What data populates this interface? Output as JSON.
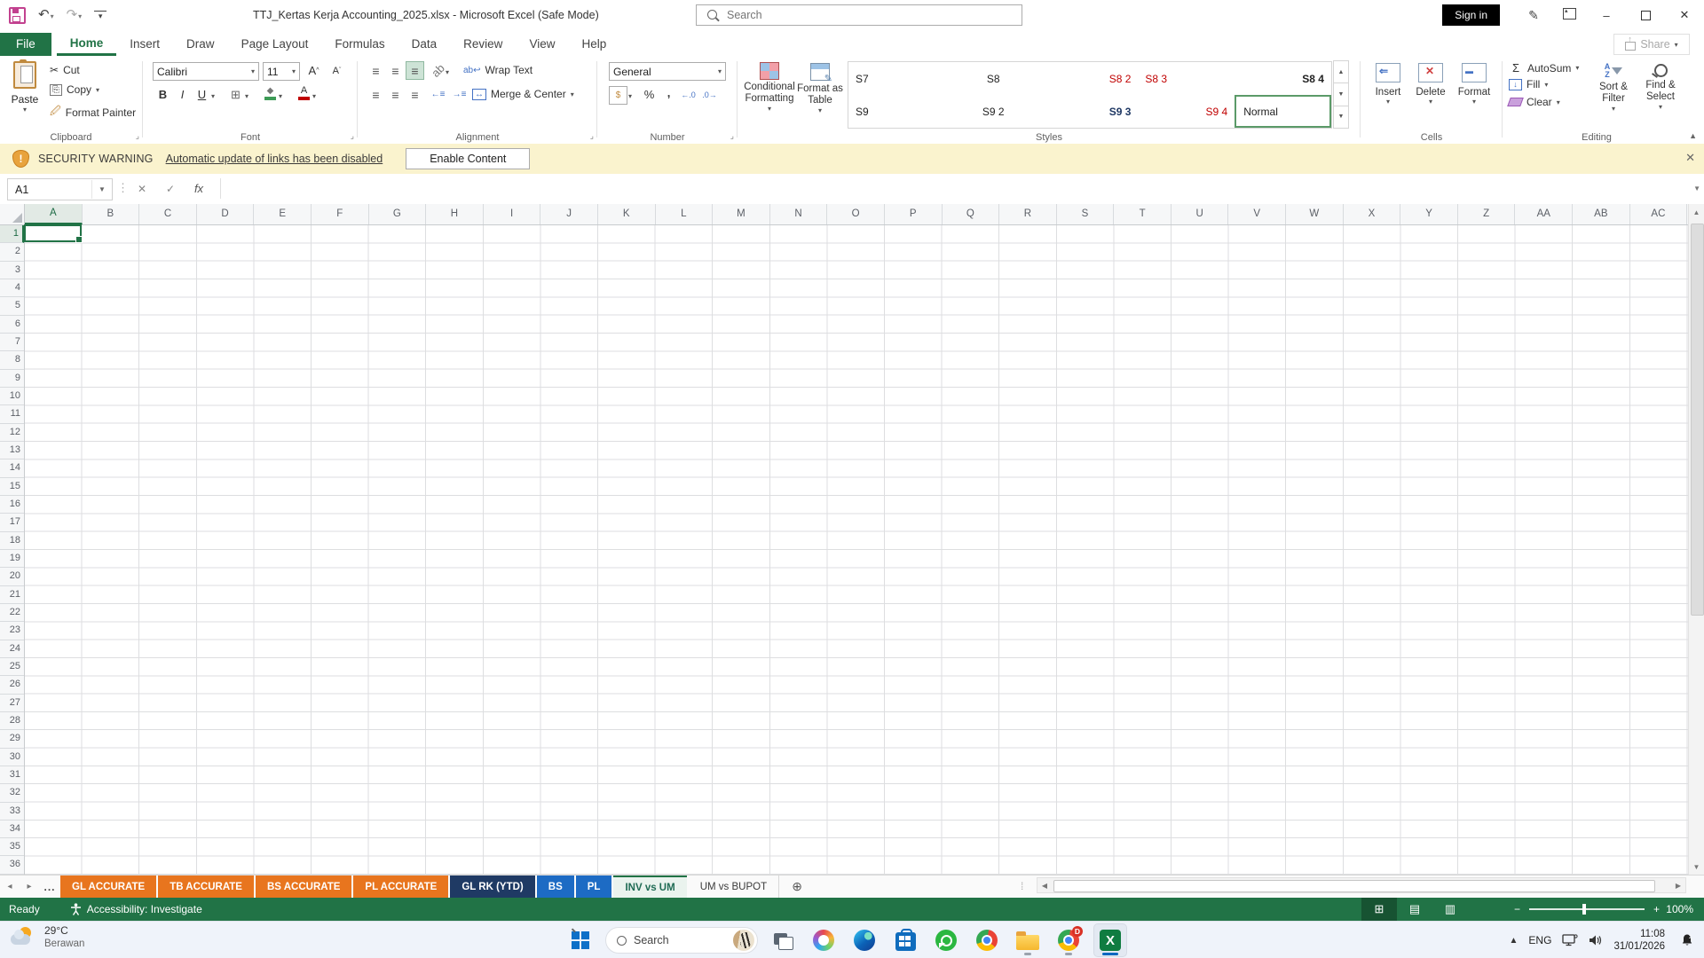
{
  "window": {
    "title": "TTJ_Kertas Kerja Accounting_2025.xlsx  -  Microsoft Excel (Safe Mode)",
    "search_placeholder": "Search",
    "sign_in_label": "Sign in",
    "share_label": "Share"
  },
  "ribbon": {
    "tabs": [
      {
        "label": "File",
        "file": true
      },
      {
        "label": "Home",
        "active": true
      },
      {
        "label": "Insert"
      },
      {
        "label": "Draw"
      },
      {
        "label": "Page Layout"
      },
      {
        "label": "Formulas"
      },
      {
        "label": "Data"
      },
      {
        "label": "Review"
      },
      {
        "label": "View"
      },
      {
        "label": "Help"
      }
    ],
    "clipboard": {
      "group": "Clipboard",
      "paste": "Paste",
      "cut": "Cut",
      "copy": "Copy",
      "format_painter": "Format Painter"
    },
    "font": {
      "group": "Font",
      "family": "Calibri",
      "size": "11"
    },
    "alignment": {
      "group": "Alignment",
      "wrap": "Wrap Text",
      "merge": "Merge & Center"
    },
    "number": {
      "group": "Number",
      "format": "General"
    },
    "styles": {
      "group": "Styles",
      "conditional": "Conditional Formatting",
      "format_table": "Format as Table",
      "gallery": [
        [
          {
            "label": "S7",
            "color": "#222222",
            "align": "left"
          },
          {
            "label": "S8",
            "color": "#222222",
            "align": "center"
          },
          {
            "label": "S8 2",
            "color": "#C00000",
            "align": "right"
          },
          {
            "label": "S8 3",
            "color": "#C00000",
            "align": "left"
          },
          {
            "label": "S8 4",
            "color": "#222222",
            "bold": true,
            "align": "right"
          }
        ],
        [
          {
            "label": "S9",
            "color": "#222222",
            "align": "left"
          },
          {
            "label": "S9 2",
            "color": "#222222",
            "align": "center"
          },
          {
            "label": "S9 3",
            "color": "#1F3864",
            "bold": true,
            "align": "right"
          },
          {
            "label": "S9 4",
            "color": "#C00000",
            "align": "right"
          },
          {
            "label": "Normal",
            "color": "#222222",
            "align": "left",
            "selected": true
          }
        ]
      ]
    },
    "cells": {
      "group": "Cells",
      "insert": "Insert",
      "delete": "Delete",
      "format": "Format"
    },
    "editing": {
      "group": "Editing",
      "autosum": "AutoSum",
      "fill": "Fill",
      "clear": "Clear",
      "sort_filter": "Sort & Filter",
      "find_select": "Find & Select"
    }
  },
  "security": {
    "label": "SECURITY WARNING",
    "message": "Automatic update of links has been disabled",
    "button": "Enable Content"
  },
  "formula": {
    "name_box": "A1",
    "fx": "fx"
  },
  "grid": {
    "columns": [
      "A",
      "B",
      "C",
      "D",
      "E",
      "F",
      "G",
      "H",
      "I",
      "J",
      "K",
      "L",
      "M",
      "N",
      "O",
      "P",
      "Q",
      "R",
      "S",
      "T",
      "U",
      "V",
      "W",
      "X",
      "Y",
      "Z",
      "AA",
      "AB",
      "AC"
    ],
    "rows": [
      1,
      2,
      3,
      4,
      5,
      6,
      7,
      8,
      9,
      10,
      11,
      12,
      13,
      14,
      15,
      16,
      17,
      18,
      19,
      20,
      21,
      22,
      23,
      24,
      25,
      26,
      27,
      28,
      29,
      30,
      31,
      32,
      33,
      34,
      35,
      36
    ],
    "active_cell": "A1"
  },
  "sheets": {
    "overflow": "...",
    "tabs": [
      {
        "label": "GL ACCURATE",
        "bg": "#E8751E",
        "fg": "#FFFFFF"
      },
      {
        "label": "TB ACCURATE",
        "bg": "#E8751E",
        "fg": "#FFFFFF"
      },
      {
        "label": "BS ACCURATE",
        "bg": "#E8751E",
        "fg": "#FFFFFF"
      },
      {
        "label": "PL ACCURATE",
        "bg": "#E8751E",
        "fg": "#FFFFFF"
      },
      {
        "label": "GL RK (YTD)",
        "bg": "#1F3A64",
        "fg": "#FFFFFF"
      },
      {
        "label": "BS",
        "bg": "#1D6BC4",
        "fg": "#FFFFFF"
      },
      {
        "label": "PL",
        "bg": "#1D6BC4",
        "fg": "#FFFFFF"
      },
      {
        "label": "INV vs UM",
        "bg": "",
        "fg": "#1F6B54",
        "active": true
      },
      {
        "label": "UM vs BUPOT",
        "bg": "",
        "fg": "#3B3B3B",
        "plain": true
      }
    ]
  },
  "status": {
    "mode": "Ready",
    "accessibility": "Accessibility: Investigate",
    "zoom": "100%"
  },
  "taskbar": {
    "weather": {
      "temp": "29°C",
      "desc": "Berawan"
    },
    "search": "Search",
    "chrome_badge": "D",
    "tray": {
      "lang": "ENG",
      "time": "11:08",
      "date": "31/01/2026"
    }
  }
}
